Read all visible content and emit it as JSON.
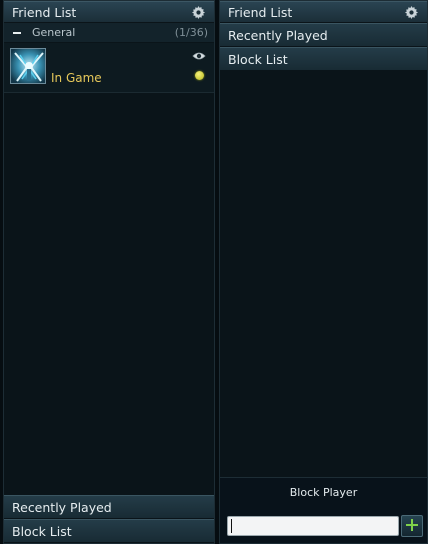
{
  "left_panel": {
    "header": {
      "title": "Friend List",
      "icon": "gear-icon"
    },
    "group": {
      "label": "General",
      "count": "(1/36)",
      "icon": "collapse-icon"
    },
    "friends": [
      {
        "status": "In Game",
        "status_color": "#e6c85a",
        "icons": [
          "eye-icon",
          "online-status-dot"
        ]
      }
    ],
    "bottom_tabs": [
      "Recently Played",
      "Block List"
    ]
  },
  "right_panel": {
    "header": {
      "title": "Friend List",
      "icon": "gear-icon"
    },
    "tabs": [
      "Recently Played",
      "Block List"
    ],
    "block": {
      "label": "Block Player",
      "input_value": "",
      "add_icon": "plus-icon"
    }
  },
  "colors": {
    "background": "#0a1419",
    "header": "#1b2e38",
    "in_game": "#e6c85a",
    "online_dot": "#d7dc3a",
    "add_plus": "#7fd14a"
  }
}
